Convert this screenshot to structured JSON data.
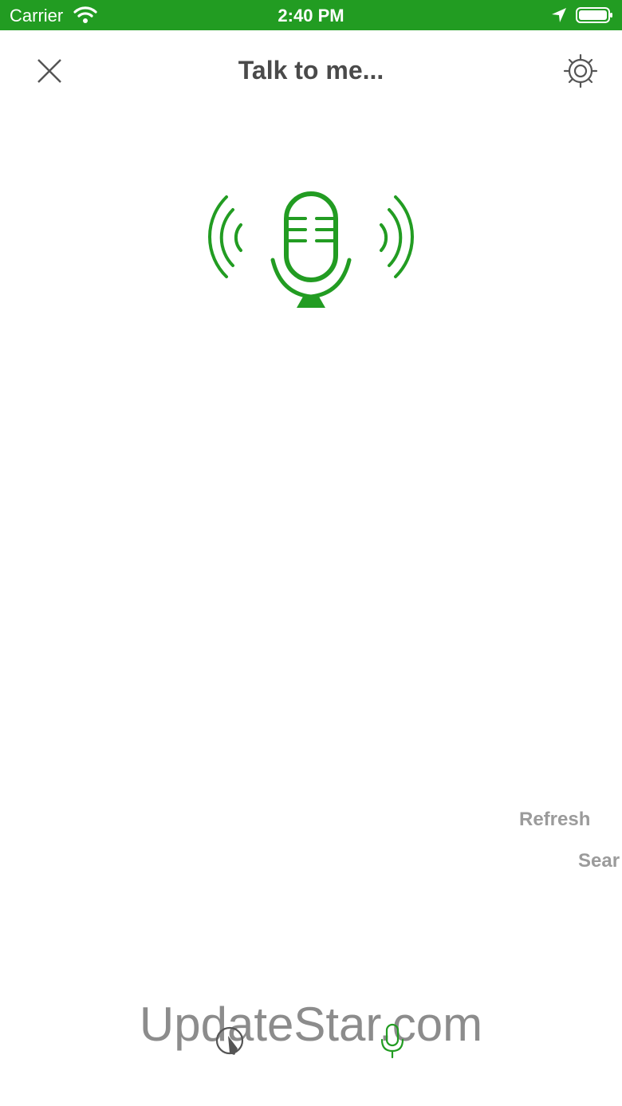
{
  "status_bar": {
    "carrier": "Carrier",
    "time": "2:40 PM",
    "background": "#229c22",
    "icons": [
      "wifi-icon",
      "location-arrow-icon",
      "battery-icon"
    ]
  },
  "nav": {
    "title": "Talk to me...",
    "close_icon": "close-icon",
    "settings_icon": "settings-gear-icon"
  },
  "hero": {
    "icon": "microphone-sound-waves-icon",
    "color": "#229c22"
  },
  "side_links": {
    "refresh": "Refresh",
    "search": "Sear"
  },
  "watermark": "UpdateStar.com",
  "tab_bar": {
    "items": [
      {
        "icon": "touch-gesture-icon",
        "active": false
      },
      {
        "icon": "microphone-icon",
        "active": true
      }
    ],
    "active_color": "#229c22",
    "inactive_color": "#555555"
  }
}
